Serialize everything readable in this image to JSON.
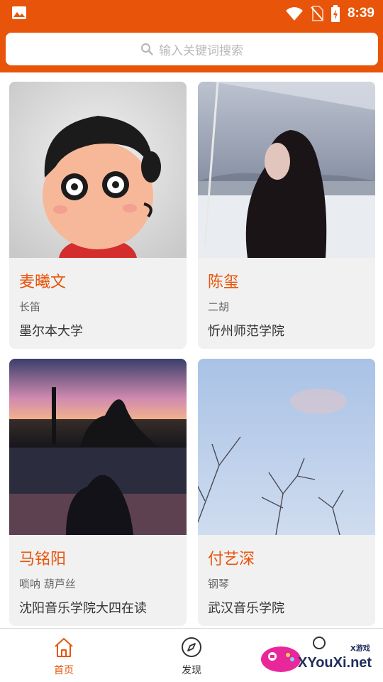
{
  "status_bar": {
    "time": "8:39",
    "icons": [
      "image-icon",
      "wifi-icon",
      "no-sim-icon",
      "battery-charging-icon"
    ]
  },
  "search": {
    "placeholder": "输入关键词搜索",
    "icon": "search-icon"
  },
  "cards": [
    {
      "name": "麦曦文",
      "instrument": "长笛",
      "school": "墨尔本大学"
    },
    {
      "name": "陈玺",
      "instrument": "二胡",
      "school": "忻州师范学院"
    },
    {
      "name": "马铭阳",
      "instrument": "唢呐 葫芦丝",
      "school": "沈阳音乐学院大四在读"
    },
    {
      "name": "付艺深",
      "instrument": "钢琴",
      "school": "武汉音乐学院"
    }
  ],
  "bottom_nav": {
    "tabs": [
      {
        "label": "首页",
        "icon": "home-icon",
        "active": true
      },
      {
        "label": "发现",
        "icon": "compass-icon",
        "active": false
      },
      {
        "label": "",
        "icon": "profile-icon",
        "active": false
      }
    ],
    "active_color": "#e8540a",
    "inactive_color": "#333333"
  },
  "watermark": {
    "text": "XYouXi.net",
    "small": "X游戏"
  },
  "colors": {
    "brand": "#e8540a",
    "card_bg": "#f1f1f1"
  }
}
